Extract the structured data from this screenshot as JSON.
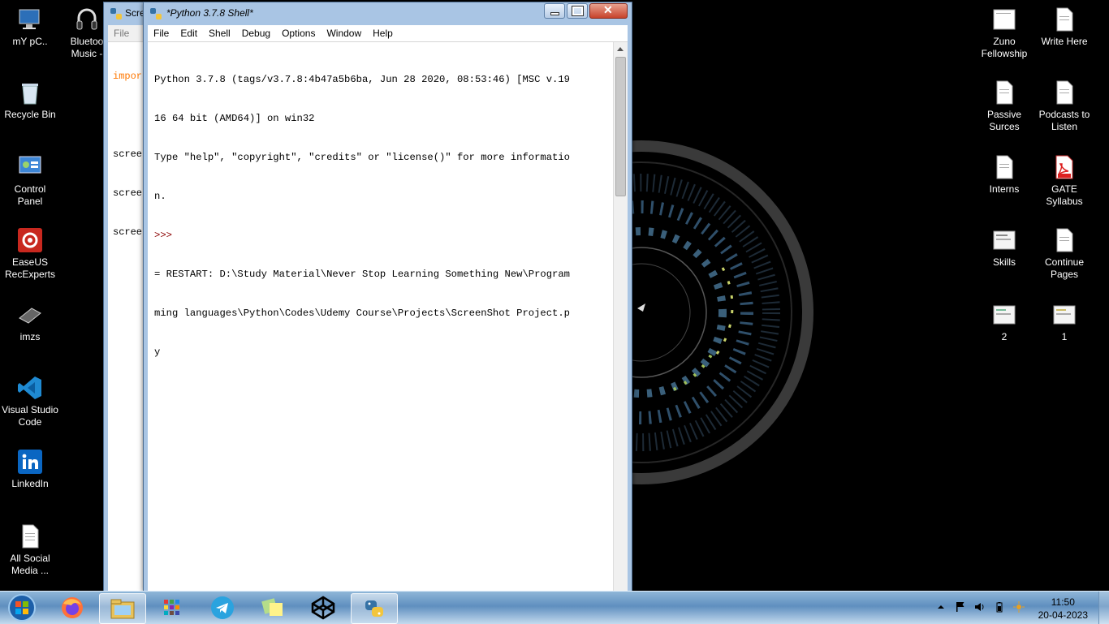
{
  "desktop": {
    "left_icons": [
      {
        "label": "mY pC..",
        "icon": "computer-icon"
      },
      {
        "label": "Recycle Bin",
        "icon": "recycle-bin-icon"
      },
      {
        "label": "Control\nPanel",
        "icon": "control-panel-icon"
      },
      {
        "label": "EaseUS\nRecExperts",
        "icon": "easeus-icon"
      },
      {
        "label": "imzs",
        "icon": "device-icon"
      },
      {
        "label": "Visual Studio\nCode",
        "icon": "vscode-icon"
      },
      {
        "label": "LinkedIn",
        "icon": "linkedin-icon"
      },
      {
        "label": "All Social\nMedia ...",
        "icon": "document-icon"
      }
    ],
    "second_column_icon": {
      "label": "Bluetoo\nMusic -",
      "icon": "headphones-icon"
    },
    "right_icons": [
      {
        "label": "Zuno\nFellowship",
        "icon": "document-icon"
      },
      {
        "label": "Write Here",
        "icon": "document-icon"
      },
      {
        "label": "Passive\nSurces",
        "icon": "document-icon"
      },
      {
        "label": "Podcasts to\nListen",
        "icon": "document-icon"
      },
      {
        "label": "Interns",
        "icon": "document-icon"
      },
      {
        "label": "GATE\nSyllabus",
        "icon": "pdf-icon"
      },
      {
        "label": "Skills",
        "icon": "image-icon"
      },
      {
        "label": "Continue\nPages",
        "icon": "document-icon"
      },
      {
        "label": "2",
        "icon": "image-icon"
      },
      {
        "label": "1",
        "icon": "image-icon"
      }
    ]
  },
  "back_window": {
    "title": "Scre",
    "menu_first": "File",
    "code_lines": [
      "impor",
      "",
      "scree",
      "scree",
      "scree"
    ]
  },
  "shell_window": {
    "title": "*Python 3.7.8 Shell*",
    "menu": [
      "File",
      "Edit",
      "Shell",
      "Debug",
      "Options",
      "Window",
      "Help"
    ],
    "lines": [
      "Python 3.7.8 (tags/v3.7.8:4b47a5b6ba, Jun 28 2020, 08:53:46) [MSC v.19",
      "16 64 bit (AMD64)] on win32",
      "Type \"help\", \"copyright\", \"credits\" or \"license()\" for more informatio",
      "n.",
      ">>> ",
      "= RESTART: D:\\Study Material\\Never Stop Learning Something New\\Program",
      "ming languages\\Python\\Codes\\Udemy Course\\Projects\\ScreenShot Project.p",
      "y"
    ]
  },
  "taskbar": {
    "items": [
      "start-orb-icon",
      "firefox-icon",
      "file-explorer-icon",
      "apps-grid-icon",
      "telegram-icon",
      "sticky-notes-icon",
      "codepen-icon",
      "python-idle-icon"
    ],
    "time": "11:50",
    "date": "20-04-2023",
    "colors": {
      "accent": "#6a9ac8"
    }
  }
}
